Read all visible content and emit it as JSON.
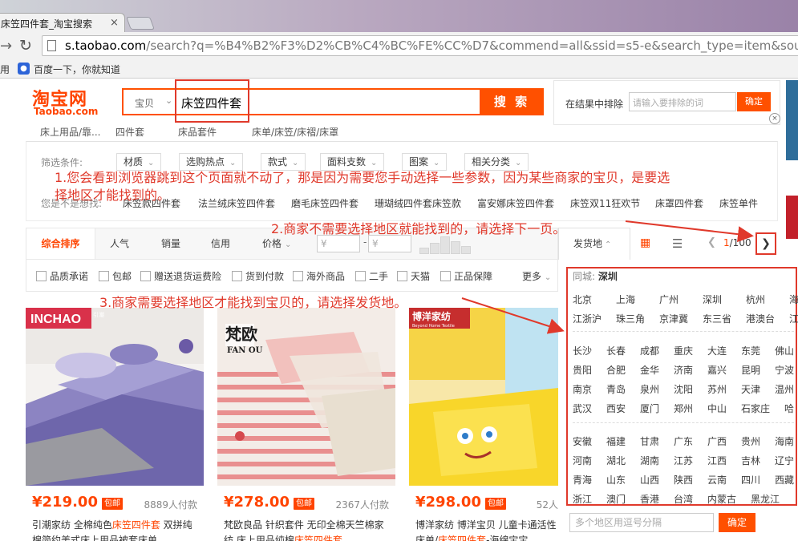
{
  "browser": {
    "tab_title": "床笠四件套_淘宝搜索",
    "tab_close": "×",
    "url_host": "s.taobao.com",
    "url_path": "/search?q=%B4%B2%F3%D2%CB%C4%BC%FE%CC%D7&commend=all&ssid=s5-e&search_type=item&sourc",
    "bookmark_apps": "用",
    "bookmark_baidu_icon": "paw-icon",
    "bookmark_baidu": "百度一下，你就知道"
  },
  "header": {
    "logo_cn": "淘宝网",
    "logo_en": "Taobao.com",
    "search_category": "宝贝",
    "search_query": "床笠四件套",
    "search_button": "搜 索",
    "exclude_label": "在结果中排除",
    "exclude_placeholder": "请输入要排除的词",
    "exclude_button": "确定",
    "close": "×"
  },
  "breadcrumb": [
    "床上用品/靠...",
    "四件套",
    "床品套件",
    "床单/床笠/床褶/床罩"
  ],
  "filters": {
    "label": "筛选条件:",
    "buttons": [
      "材质",
      "选购热点",
      "款式",
      "面料支数",
      "图案",
      "相关分类"
    ],
    "suggest_label": "您是不是想找:",
    "suggestions": [
      "床笠款四件套",
      "法兰绒床笠四件套",
      "磨毛床笠四件套",
      "珊瑚绒四件套床笠款",
      "富安娜床笠四件套",
      "床笠双11狂欢节",
      "床罩四件套",
      "床笠单件"
    ]
  },
  "sortbar": {
    "default": "综合排序",
    "popularity": "人气",
    "sales": "销量",
    "credit": "信用",
    "price": "价格",
    "price_from": "¥",
    "price_dash": "-",
    "price_to": "¥"
  },
  "checks": [
    "品质承诺",
    "包邮",
    "赠送退货运费险",
    "货到付款",
    "海外商品",
    "二手",
    "天猫",
    "正品保障"
  ],
  "more": "更多",
  "location": {
    "tab_label": "发货地",
    "pager_current": "1",
    "pager_total": "/100",
    "same_city_label": "同城:",
    "same_city": "深圳",
    "group1": [
      [
        "北京",
        "上海",
        "广州",
        "深圳",
        "杭州",
        "海"
      ],
      [
        "江浙沪",
        "珠三角",
        "京津冀",
        "东三省",
        "港澳台",
        "江"
      ]
    ],
    "group2": [
      [
        "长沙",
        "长春",
        "成都",
        "重庆",
        "大连",
        "东莞",
        "佛山"
      ],
      [
        "贵阳",
        "合肥",
        "金华",
        "济南",
        "嘉兴",
        "昆明",
        "宁波"
      ],
      [
        "南京",
        "青岛",
        "泉州",
        "沈阳",
        "苏州",
        "天津",
        "温州"
      ],
      [
        "武汉",
        "西安",
        "厦门",
        "郑州",
        "中山",
        "石家庄",
        "哈"
      ]
    ],
    "group3": [
      [
        "安徽",
        "福建",
        "甘肃",
        "广东",
        "广西",
        "贵州",
        "海南"
      ],
      [
        "河南",
        "湖北",
        "湖南",
        "江苏",
        "江西",
        "吉林",
        "辽宁"
      ],
      [
        "青海",
        "山东",
        "山西",
        "陕西",
        "云南",
        "四川",
        "西藏"
      ],
      [
        "浙江",
        "澳门",
        "香港",
        "台湾",
        "内蒙古",
        "黑龙江"
      ]
    ],
    "input_placeholder": "多个地区用逗号分隔",
    "confirm": "确定"
  },
  "products": [
    {
      "brand": "INCHAO",
      "brand_sub": "引潮",
      "price": "¥219.00",
      "badge": "包邮",
      "sales": "8889人付款",
      "title1_pre": "引潮家纺 全棉纯色",
      "title1_hl": "床笠四件套",
      "title1_post": " 双拼纯",
      "title2": "棉简约美式床上用品被套床单"
    },
    {
      "brand": "梵欧",
      "brand_sub": "FAN OU",
      "price": "¥278.00",
      "badge": "包邮",
      "sales": "2367人付款",
      "title1_pre": "梵欧良品 针织套件 无印全棉天竺棉家",
      "title1_hl": "",
      "title1_post": "",
      "title2_pre": "纺 床上用品纯棉",
      "title2_hl": "床笠四件套"
    },
    {
      "brand": "博洋家纺",
      "brand_sub": "Beyond Home Textile",
      "price": "¥298.00",
      "badge": "包邮",
      "sales": "52人",
      "title1_pre": "博洋家纺 博洋宝贝 儿童卡通活性",
      "title1_hl": "",
      "title1_post": "",
      "title2_pre": "床单/",
      "title2_hl": "床笠四件套",
      "title2_post": "-海绵宝宝"
    }
  ],
  "annotations": {
    "note1_line1": "1.您会看到浏览器跳到这个页面就不动了，那是因为需要您手动选择一些参数，因为某些商家的宝贝，是要选",
    "note1_line2": "择地区才能找到的。",
    "note2": "2.商家不需要选择地区就能找到的，请选择下一页。",
    "note3": "3.商家需要选择地区才能找到宝贝的，请选择发货地。"
  },
  "colors": {
    "accent": "#ff5000",
    "price": "#ff4400",
    "annotation": "#e0392b"
  }
}
